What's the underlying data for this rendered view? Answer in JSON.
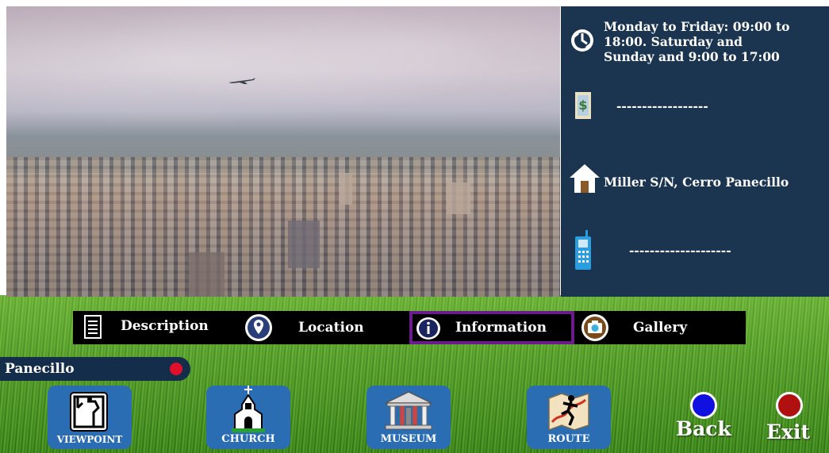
{
  "info": {
    "hours": "Monday to Friday: 09:00 to 18:00. Saturday and Sunday and 9:00 to 17:00",
    "hours_lines": [
      "Monday to Friday: 09:00 to",
      "18:00. Saturday and",
      "Sunday and 9:00 to 17:00"
    ],
    "price": "------------------",
    "address": "Miller S/N, Cerro Panecillo",
    "phone": "--------------------"
  },
  "icons": {
    "hours": "clock-icon",
    "price": "money-icon",
    "address": "house-icon",
    "phone": "phone-icon"
  },
  "tabs": [
    {
      "label": "Description",
      "icon": "document-icon"
    },
    {
      "label": "Location",
      "icon": "location-pin-icon"
    },
    {
      "label": "Information",
      "icon": "info-icon",
      "selected": true
    },
    {
      "label": "Gallery",
      "icon": "camera-icon"
    }
  ],
  "place": {
    "label": "Panecillo"
  },
  "nav": [
    {
      "label": "VIEWPOINT",
      "icon": "viewpoint-icon"
    },
    {
      "label": "CHURCH",
      "icon": "church-icon"
    },
    {
      "label": "MUSEUM",
      "icon": "museum-icon"
    },
    {
      "label": "ROUTE",
      "icon": "route-icon"
    }
  ],
  "controls": {
    "back": "Back",
    "exit": "Exit"
  },
  "colors": {
    "panel": "#1b3550",
    "tab_selected_border": "#6a1a8a",
    "nav_button": "#2a6db3",
    "place_dot": "#e0102c",
    "back_dot": "#1010e0",
    "exit_dot": "#b01010"
  }
}
